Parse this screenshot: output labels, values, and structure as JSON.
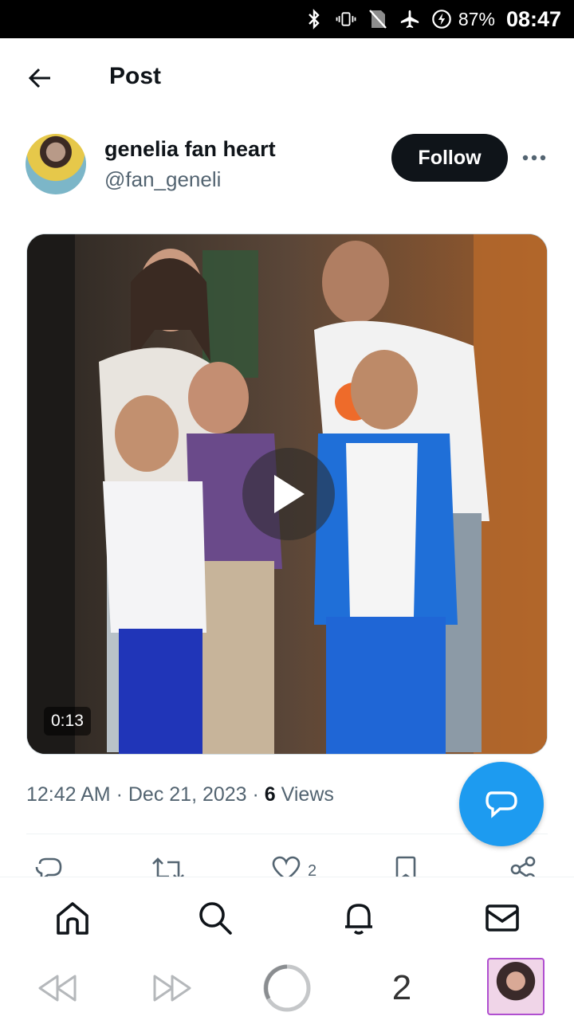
{
  "status_bar": {
    "battery": "87%",
    "time": "08:47"
  },
  "header": {
    "title": "Post"
  },
  "post": {
    "author_name": "genelia fan heart",
    "author_handle": "@fan_geneli",
    "follow_label": "Follow",
    "video_duration": "0:13",
    "time": "12:42 AM",
    "separator": " · ",
    "date": "Dec 21, 2023",
    "views_count": "6",
    "views_label": "Views",
    "like_count": "2"
  },
  "colors": {
    "accent": "#1d9bf0",
    "text": "#0f1419",
    "muted": "#536471",
    "follow_bg": "#0f1419"
  },
  "bottom_nav": [
    "home-icon",
    "search-icon",
    "bell-icon",
    "mail-icon"
  ],
  "system_bar": {
    "tab_count": "2"
  }
}
